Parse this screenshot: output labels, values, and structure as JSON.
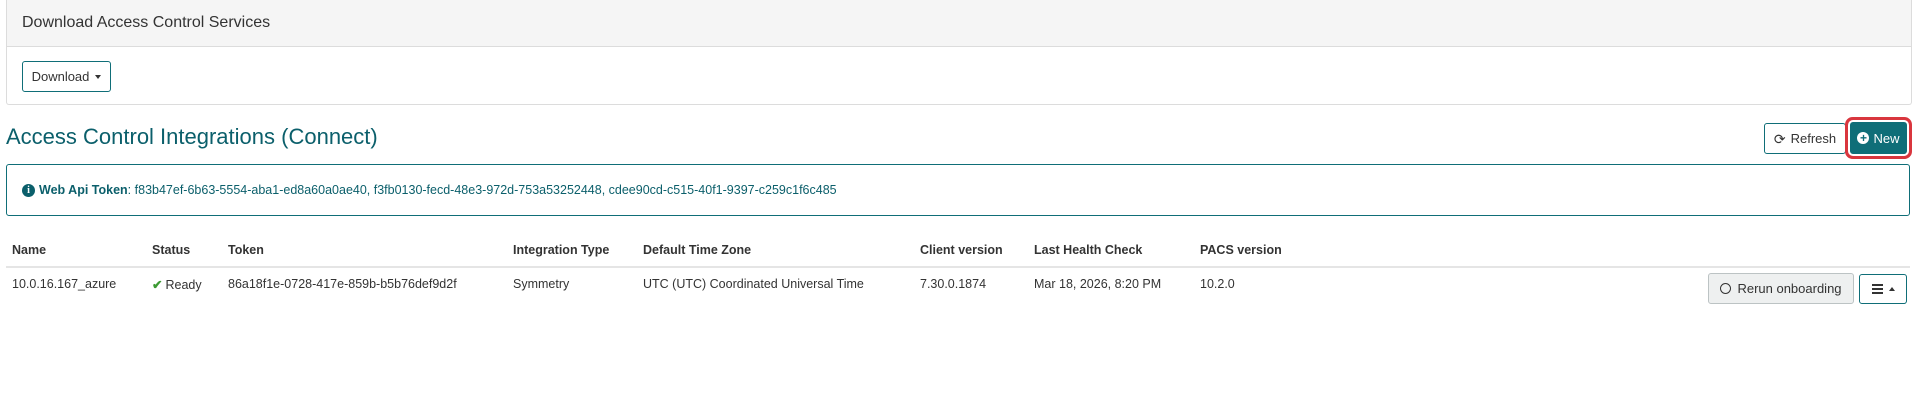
{
  "download_panel": {
    "title": "Download Access Control Services",
    "download_label": "Download"
  },
  "integrations": {
    "title": "Access Control Integrations (Connect)",
    "refresh_label": "Refresh",
    "new_label": "New"
  },
  "token_alert": {
    "label": "Web Api Token",
    "separator": ":",
    "tokens": "f83b47ef-6b63-5554-aba1-ed8a60a0ae40, f3fb0130-fecd-48e3-972d-753a53252448, cdee90cd-c515-40f1-9397-c259c1f6c485"
  },
  "table": {
    "columns": [
      "Name",
      "Status",
      "Token",
      "Integration Type",
      "Default Time Zone",
      "Client version",
      "Last Health Check",
      "PACS version"
    ],
    "rows": [
      {
        "name": "10.0.16.167_azure",
        "status": "Ready",
        "token": "86a18f1e-0728-417e-859b-b5b76def9d2f",
        "integration_type": "Symmetry",
        "time_zone": "UTC (UTC) Coordinated Universal Time",
        "client_version": "7.30.0.1874",
        "last_health_check": "Mar 18, 2026, 8:20 PM",
        "pacs_version": "10.2.0",
        "rerun_label": "Rerun onboarding"
      }
    ]
  },
  "icons": {
    "download_caret": "caret-down-icon",
    "refresh": "refresh-icon",
    "new": "plus-circle-icon",
    "info": "info-circle-icon",
    "status_ready": "check-icon",
    "rerun": "circle-icon",
    "menu": "hamburger-menu-icon"
  },
  "colors": {
    "accent": "#0f6e78",
    "title_text": "#0b5f6b",
    "highlight": "#d9363e",
    "ready": "#3c9a33"
  }
}
